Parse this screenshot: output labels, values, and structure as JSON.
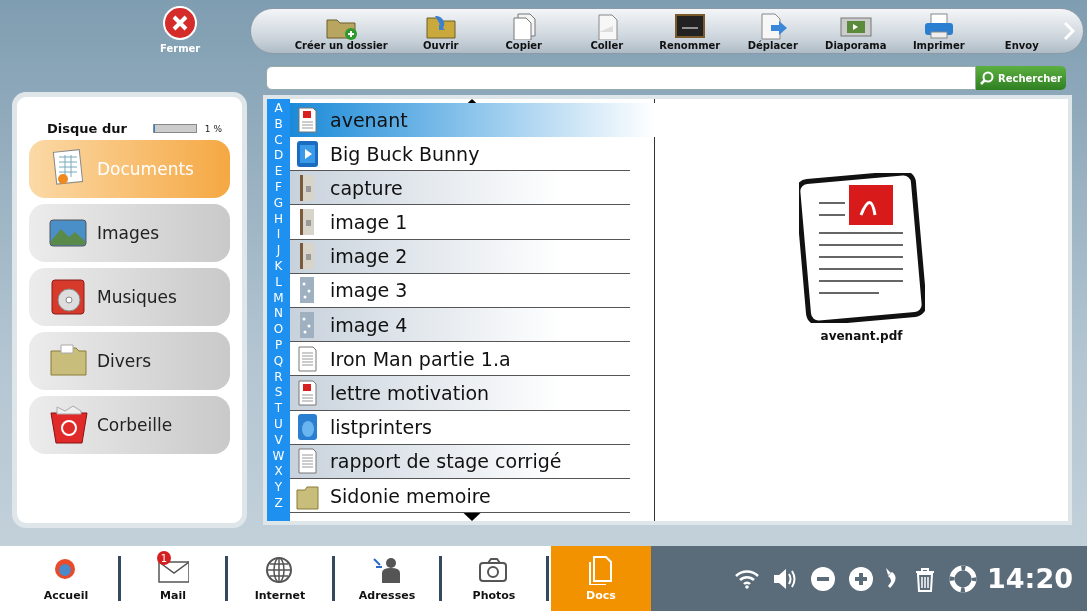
{
  "close_button": {
    "label": "Fermer"
  },
  "toolbar": [
    {
      "kind": "new-folder",
      "label": "Créer un dossier"
    },
    {
      "kind": "open",
      "label": "Ouvrir"
    },
    {
      "kind": "copy",
      "label": "Copier"
    },
    {
      "kind": "paste",
      "label": "Coller"
    },
    {
      "kind": "rename",
      "label": "Renommer"
    },
    {
      "kind": "move",
      "label": "Déplacer"
    },
    {
      "kind": "slideshow",
      "label": "Diaporama"
    },
    {
      "kind": "print",
      "label": "Imprimer"
    },
    {
      "kind": "none",
      "label": "Envoy"
    }
  ],
  "search": {
    "button": "Rechercher"
  },
  "disk": {
    "title": "Disque dur",
    "level": 0.01,
    "reading": "1 %"
  },
  "categories": [
    {
      "kind": "documents",
      "label": "Documents",
      "selected": true
    },
    {
      "kind": "images",
      "label": "Images",
      "selected": false
    },
    {
      "kind": "music",
      "label": "Musiques",
      "selected": false
    },
    {
      "kind": "folder",
      "label": "Divers",
      "selected": false
    },
    {
      "kind": "trash",
      "label": "Corbeille",
      "selected": false
    }
  ],
  "alphabet": [
    "A",
    "B",
    "C",
    "D",
    "E",
    "F",
    "G",
    "H",
    "I",
    "J",
    "K",
    "L",
    "M",
    "N",
    "O",
    "P",
    "Q",
    "R",
    "S",
    "T",
    "U",
    "V",
    "W",
    "X",
    "Y",
    "Z"
  ],
  "files": [
    {
      "kind": "pdf",
      "name": "avenant",
      "selected": true
    },
    {
      "kind": "video",
      "name": "Big Buck Bunny",
      "selected": false
    },
    {
      "kind": "photo",
      "name": "capture",
      "selected": false
    },
    {
      "kind": "photo",
      "name": "image 1",
      "selected": false
    },
    {
      "kind": "photo",
      "name": "image 2",
      "selected": false
    },
    {
      "kind": "snow",
      "name": "image 3",
      "selected": false
    },
    {
      "kind": "snow",
      "name": "image 4",
      "selected": false
    },
    {
      "kind": "doc",
      "name": "Iron Man partie 1.a",
      "selected": false
    },
    {
      "kind": "pdf",
      "name": "lettre motivation",
      "selected": false
    },
    {
      "kind": "app",
      "name": "listprinters",
      "selected": false
    },
    {
      "kind": "doc",
      "name": "rapport de stage corrigé",
      "selected": false
    },
    {
      "kind": "folder",
      "name": "Sidonie memoire",
      "selected": false
    }
  ],
  "preview": {
    "kind": "pdf",
    "filename": "avenant.pdf"
  },
  "taskbar": [
    {
      "kind": "home",
      "label": "Accueil",
      "selected": false
    },
    {
      "kind": "mail",
      "label": "Mail",
      "badge": "1",
      "selected": false
    },
    {
      "kind": "globe",
      "label": "Internet",
      "selected": false
    },
    {
      "kind": "contacts",
      "label": "Adresses",
      "selected": false
    },
    {
      "kind": "camera",
      "label": "Photos",
      "selected": false
    },
    {
      "kind": "docs",
      "label": "Docs",
      "selected": true
    }
  ],
  "status": {
    "time": "14:20"
  }
}
